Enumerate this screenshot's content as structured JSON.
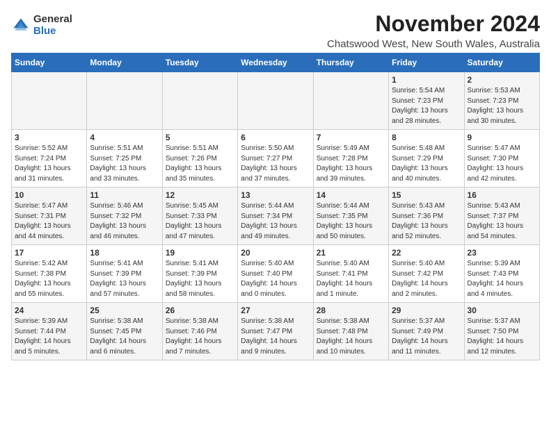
{
  "logo": {
    "general": "General",
    "blue": "Blue"
  },
  "title": "November 2024",
  "subtitle": "Chatswood West, New South Wales, Australia",
  "days_of_week": [
    "Sunday",
    "Monday",
    "Tuesday",
    "Wednesday",
    "Thursday",
    "Friday",
    "Saturday"
  ],
  "weeks": [
    [
      {
        "day": "",
        "info": ""
      },
      {
        "day": "",
        "info": ""
      },
      {
        "day": "",
        "info": ""
      },
      {
        "day": "",
        "info": ""
      },
      {
        "day": "",
        "info": ""
      },
      {
        "day": "1",
        "info": "Sunrise: 5:54 AM\nSunset: 7:23 PM\nDaylight: 13 hours and 28 minutes."
      },
      {
        "day": "2",
        "info": "Sunrise: 5:53 AM\nSunset: 7:23 PM\nDaylight: 13 hours and 30 minutes."
      }
    ],
    [
      {
        "day": "3",
        "info": "Sunrise: 5:52 AM\nSunset: 7:24 PM\nDaylight: 13 hours and 31 minutes."
      },
      {
        "day": "4",
        "info": "Sunrise: 5:51 AM\nSunset: 7:25 PM\nDaylight: 13 hours and 33 minutes."
      },
      {
        "day": "5",
        "info": "Sunrise: 5:51 AM\nSunset: 7:26 PM\nDaylight: 13 hours and 35 minutes."
      },
      {
        "day": "6",
        "info": "Sunrise: 5:50 AM\nSunset: 7:27 PM\nDaylight: 13 hours and 37 minutes."
      },
      {
        "day": "7",
        "info": "Sunrise: 5:49 AM\nSunset: 7:28 PM\nDaylight: 13 hours and 39 minutes."
      },
      {
        "day": "8",
        "info": "Sunrise: 5:48 AM\nSunset: 7:29 PM\nDaylight: 13 hours and 40 minutes."
      },
      {
        "day": "9",
        "info": "Sunrise: 5:47 AM\nSunset: 7:30 PM\nDaylight: 13 hours and 42 minutes."
      }
    ],
    [
      {
        "day": "10",
        "info": "Sunrise: 5:47 AM\nSunset: 7:31 PM\nDaylight: 13 hours and 44 minutes."
      },
      {
        "day": "11",
        "info": "Sunrise: 5:46 AM\nSunset: 7:32 PM\nDaylight: 13 hours and 46 minutes."
      },
      {
        "day": "12",
        "info": "Sunrise: 5:45 AM\nSunset: 7:33 PM\nDaylight: 13 hours and 47 minutes."
      },
      {
        "day": "13",
        "info": "Sunrise: 5:44 AM\nSunset: 7:34 PM\nDaylight: 13 hours and 49 minutes."
      },
      {
        "day": "14",
        "info": "Sunrise: 5:44 AM\nSunset: 7:35 PM\nDaylight: 13 hours and 50 minutes."
      },
      {
        "day": "15",
        "info": "Sunrise: 5:43 AM\nSunset: 7:36 PM\nDaylight: 13 hours and 52 minutes."
      },
      {
        "day": "16",
        "info": "Sunrise: 5:43 AM\nSunset: 7:37 PM\nDaylight: 13 hours and 54 minutes."
      }
    ],
    [
      {
        "day": "17",
        "info": "Sunrise: 5:42 AM\nSunset: 7:38 PM\nDaylight: 13 hours and 55 minutes."
      },
      {
        "day": "18",
        "info": "Sunrise: 5:41 AM\nSunset: 7:39 PM\nDaylight: 13 hours and 57 minutes."
      },
      {
        "day": "19",
        "info": "Sunrise: 5:41 AM\nSunset: 7:39 PM\nDaylight: 13 hours and 58 minutes."
      },
      {
        "day": "20",
        "info": "Sunrise: 5:40 AM\nSunset: 7:40 PM\nDaylight: 14 hours and 0 minutes."
      },
      {
        "day": "21",
        "info": "Sunrise: 5:40 AM\nSunset: 7:41 PM\nDaylight: 14 hours and 1 minute."
      },
      {
        "day": "22",
        "info": "Sunrise: 5:40 AM\nSunset: 7:42 PM\nDaylight: 14 hours and 2 minutes."
      },
      {
        "day": "23",
        "info": "Sunrise: 5:39 AM\nSunset: 7:43 PM\nDaylight: 14 hours and 4 minutes."
      }
    ],
    [
      {
        "day": "24",
        "info": "Sunrise: 5:39 AM\nSunset: 7:44 PM\nDaylight: 14 hours and 5 minutes."
      },
      {
        "day": "25",
        "info": "Sunrise: 5:38 AM\nSunset: 7:45 PM\nDaylight: 14 hours and 6 minutes."
      },
      {
        "day": "26",
        "info": "Sunrise: 5:38 AM\nSunset: 7:46 PM\nDaylight: 14 hours and 7 minutes."
      },
      {
        "day": "27",
        "info": "Sunrise: 5:38 AM\nSunset: 7:47 PM\nDaylight: 14 hours and 9 minutes."
      },
      {
        "day": "28",
        "info": "Sunrise: 5:38 AM\nSunset: 7:48 PM\nDaylight: 14 hours and 10 minutes."
      },
      {
        "day": "29",
        "info": "Sunrise: 5:37 AM\nSunset: 7:49 PM\nDaylight: 14 hours and 11 minutes."
      },
      {
        "day": "30",
        "info": "Sunrise: 5:37 AM\nSunset: 7:50 PM\nDaylight: 14 hours and 12 minutes."
      }
    ]
  ]
}
